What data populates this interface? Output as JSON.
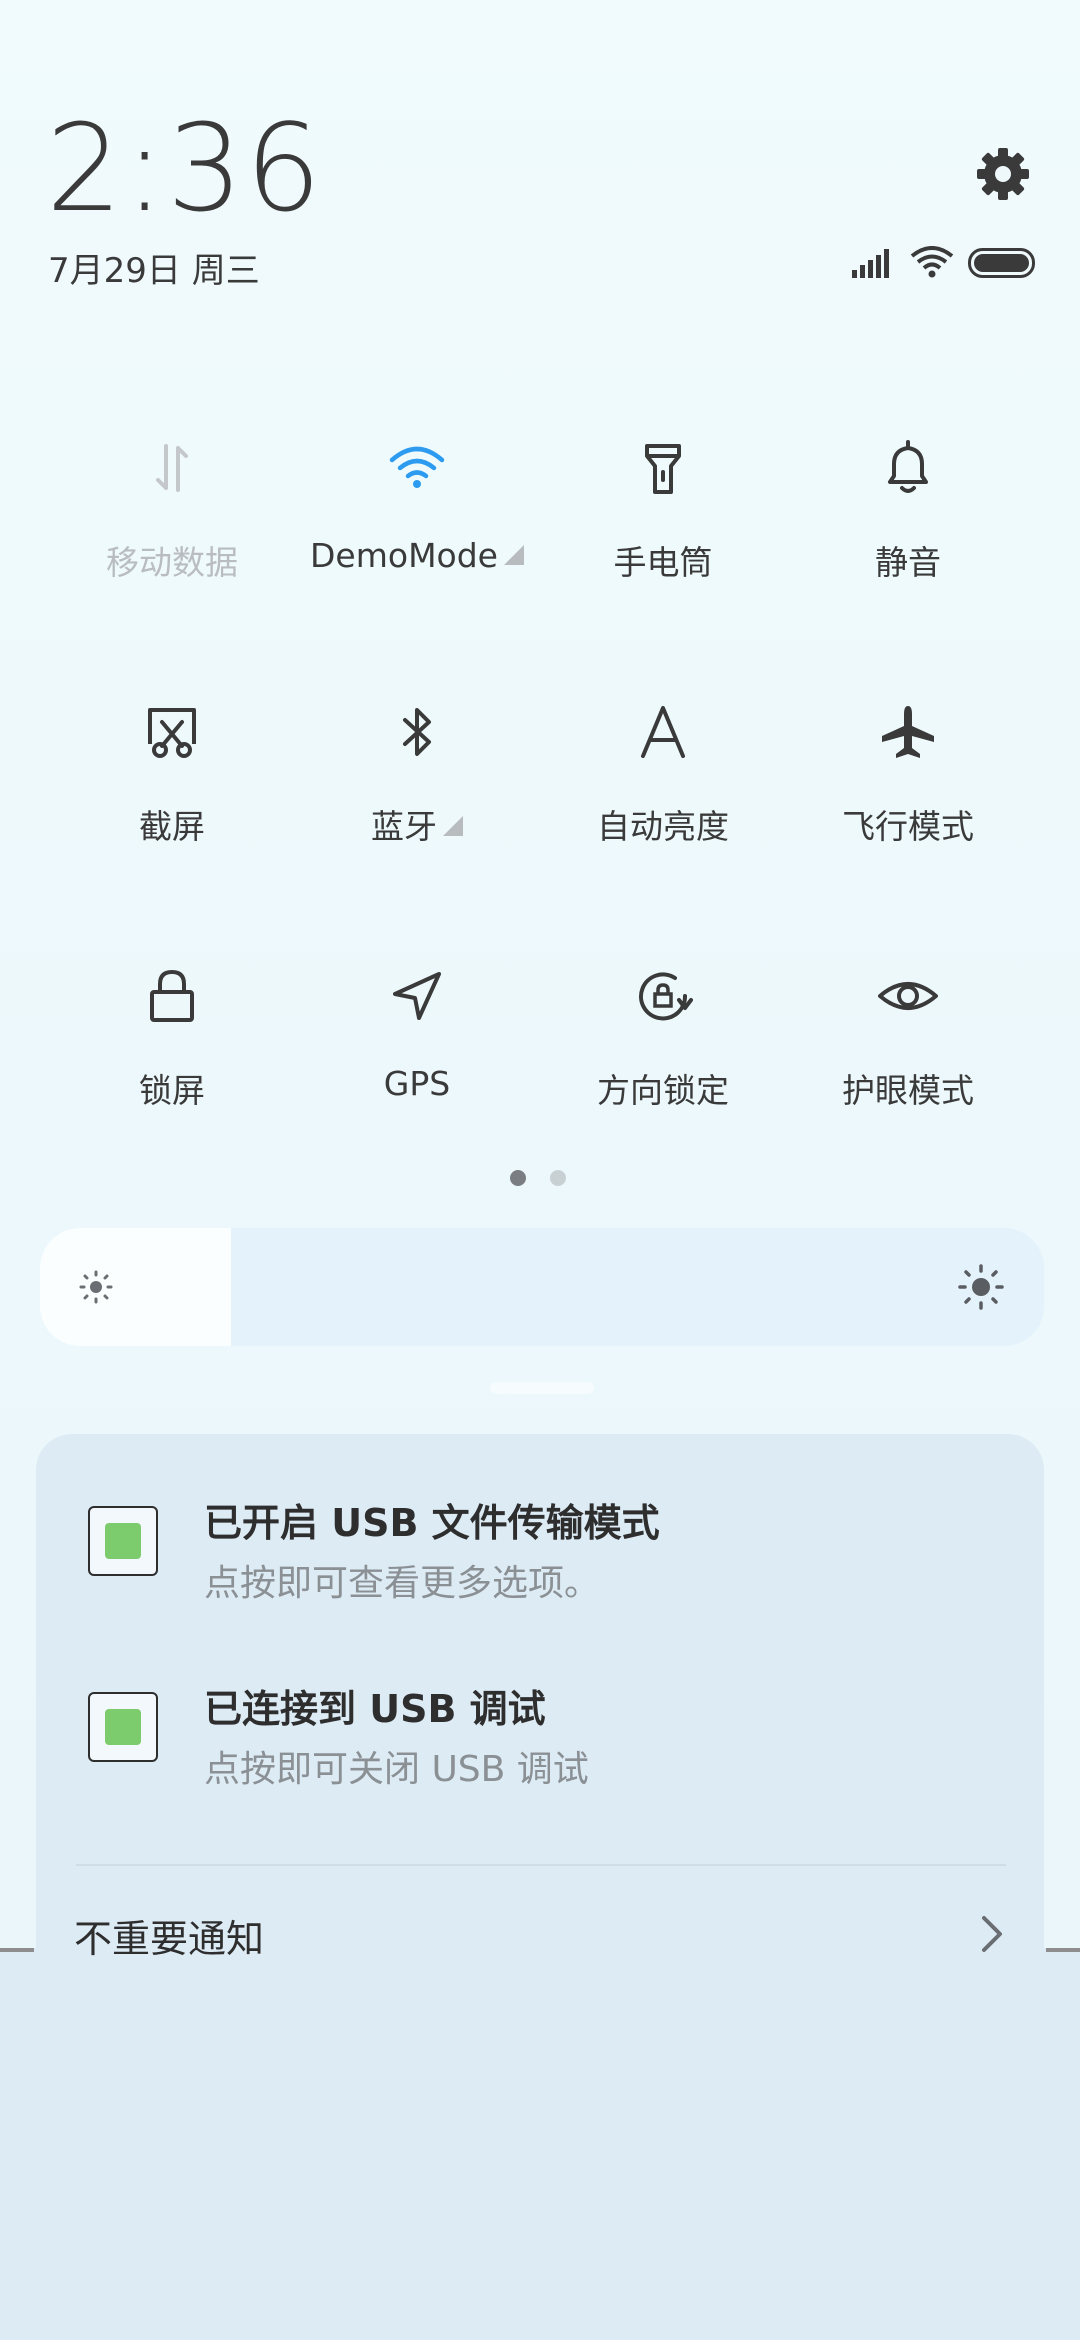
{
  "status": {
    "time": "2:36",
    "date": "7月29日 周三"
  },
  "quick_settings": {
    "tiles": [
      {
        "label": "移动数据",
        "icon": "mobile-data-icon",
        "state": "off"
      },
      {
        "label": "DemoMode",
        "icon": "wifi-icon",
        "state": "on"
      },
      {
        "label": "手电筒",
        "icon": "flashlight-icon",
        "state": "off"
      },
      {
        "label": "静音",
        "icon": "bell-icon",
        "state": "off"
      },
      {
        "label": "截屏",
        "icon": "screenshot-icon",
        "state": "off"
      },
      {
        "label": "蓝牙",
        "icon": "bluetooth-icon",
        "state": "off"
      },
      {
        "label": "自动亮度",
        "icon": "auto-brightness-icon",
        "state": "off"
      },
      {
        "label": "飞行模式",
        "icon": "airplane-icon",
        "state": "off"
      },
      {
        "label": "锁屏",
        "icon": "lock-icon",
        "state": "off"
      },
      {
        "label": "GPS",
        "icon": "location-arrow-icon",
        "state": "off"
      },
      {
        "label": "方向锁定",
        "icon": "rotation-lock-icon",
        "state": "off"
      },
      {
        "label": "护眼模式",
        "icon": "eye-icon",
        "state": "off"
      }
    ],
    "page_count": 2,
    "current_page": 1
  },
  "brightness": {
    "level": 0.19
  },
  "notifications": [
    {
      "title": "已开启 USB 文件传输模式",
      "subtitle": "点按即可查看更多选项。",
      "icon": "android-debug-icon"
    },
    {
      "title": "已连接到 USB 调试",
      "subtitle": "点按即可关闭 USB 调试",
      "icon": "android-debug-icon"
    }
  ],
  "unimportant": {
    "label": "不重要通知"
  },
  "colors": {
    "accent": "#2d9cf0",
    "text": "#3a3a3a",
    "dim": "#b9bdc0"
  }
}
